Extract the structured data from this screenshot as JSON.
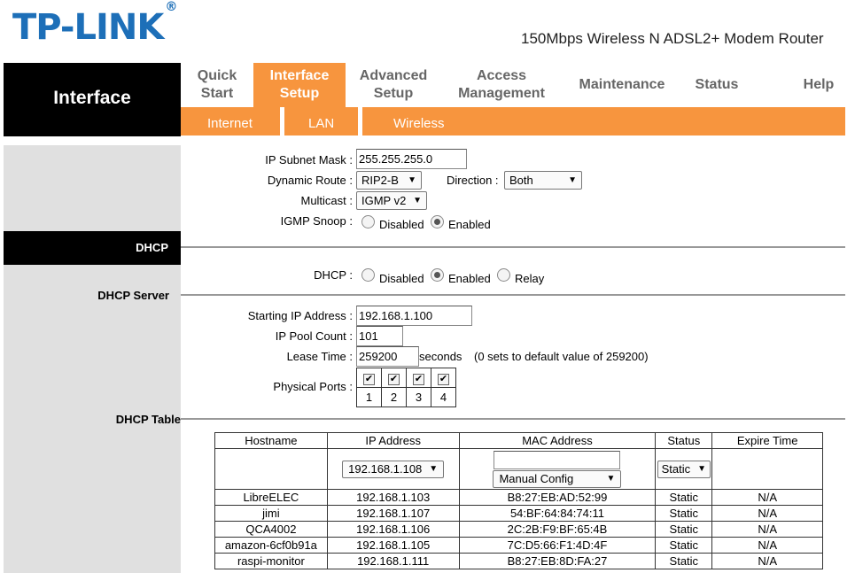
{
  "brand": {
    "logo": "TP-LINK",
    "reg": "®",
    "model": "150Mbps Wireless N ADSL2+ Modem Router"
  },
  "section_title": "Interface",
  "nav": {
    "quick_start": "Quick Start",
    "interface_setup": "Interface Setup",
    "advanced_setup": "Advanced Setup",
    "access_management": "Access Management",
    "maintenance": "Maintenance",
    "status": "Status",
    "help": "Help"
  },
  "subnav": {
    "internet": "Internet",
    "lan": "LAN",
    "wireless": "Wireless"
  },
  "lan": {
    "subnet_label": "IP Subnet Mask :",
    "subnet_value": "255.255.255.0",
    "dynamic_route_label": "Dynamic Route :",
    "dynamic_route_value": "RIP2-B",
    "direction_label": "Direction :",
    "direction_value": "Both",
    "multicast_label": "Multicast :",
    "multicast_value": "IGMP v2",
    "igmp_snoop_label": "IGMP Snoop :",
    "disabled": "Disabled",
    "enabled": "Enabled"
  },
  "dhcp": {
    "band_label": "DHCP",
    "dhcp_label": "DHCP :",
    "opt_disabled": "Disabled",
    "opt_enabled": "Enabled",
    "opt_relay": "Relay",
    "selected": "Enabled"
  },
  "dhcp_server": {
    "heading": "DHCP Server",
    "start_ip_label": "Starting IP Address :",
    "start_ip": "192.168.1.100",
    "pool_label": "IP Pool Count :",
    "pool": "101",
    "lease_label": "Lease Time :",
    "lease": "259200",
    "seconds": "seconds",
    "lease_note": "(0 sets to default value of 259200)",
    "ports_label": "Physical Ports :",
    "ports": [
      "1",
      "2",
      "3",
      "4"
    ],
    "ports_checked": [
      true,
      true,
      true,
      true
    ]
  },
  "dhcp_table": {
    "heading": "DHCP Table",
    "columns": [
      "Hostname",
      "IP Address",
      "MAC Address",
      "Status",
      "Expire Time"
    ],
    "add_ip": "192.168.1.108",
    "add_mac_mode": "Manual Config",
    "add_status": "Static",
    "rows": [
      [
        "LibreELEC",
        "192.168.1.103",
        "B8:27:EB:AD:52:99",
        "Static",
        "N/A"
      ],
      [
        "jimi",
        "192.168.1.107",
        "54:BF:64:84:74:11",
        "Static",
        "N/A"
      ],
      [
        "QCA4002",
        "192.168.1.106",
        "2C:2B:F9:BF:65:4B",
        "Static",
        "N/A"
      ],
      [
        "amazon-6cf0b91a",
        "192.168.1.105",
        "7C:D5:66:F1:4D:4F",
        "Static",
        "N/A"
      ],
      [
        "raspi-monitor",
        "192.168.1.111",
        "B8:27:EB:8D:FA:27",
        "Static",
        "N/A"
      ]
    ]
  },
  "colors": {
    "accent": "#f7953e",
    "brand": "#1d6fb8",
    "sidebar": "#e0e0e0"
  }
}
